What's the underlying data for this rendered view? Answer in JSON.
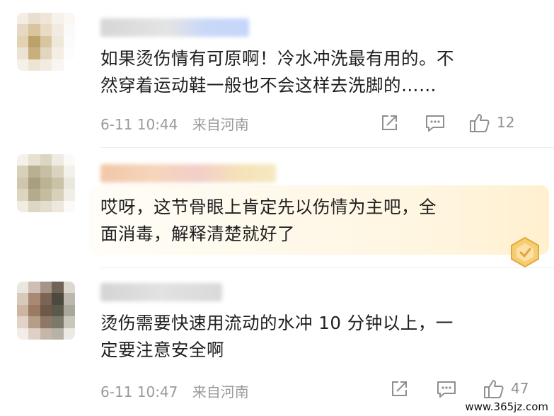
{
  "comments": [
    {
      "text_line1": "如果烫伤情有可原啊！冷水冲洗最有用的。不",
      "text_line2": "然穿着运动鞋一般也不会这样去洗脚的……",
      "time": "6-11 10:44",
      "location": "来自河南",
      "like_count": "12"
    },
    {
      "text_line1": "哎呀，这节骨眼上肯定先以伤情为主吧，全",
      "text_line2": "面消毒，解释清楚就好了"
    },
    {
      "text_line1": "烫伤需要快速用流动的水冲 10 分钟以上，一",
      "text_line2": "定要注意安全啊",
      "time": "6-11 10:47",
      "location": "来自河南",
      "like_count": "47"
    }
  ],
  "icons": {
    "share": "share-icon",
    "reply": "comment-icon",
    "like": "thumbs-up-icon",
    "badge": "gold-badge-icon"
  },
  "colors": {
    "meta_gray": "#9a9a9a",
    "bubble_gold": "#f4c56a"
  },
  "watermark": "www.365jz.com"
}
